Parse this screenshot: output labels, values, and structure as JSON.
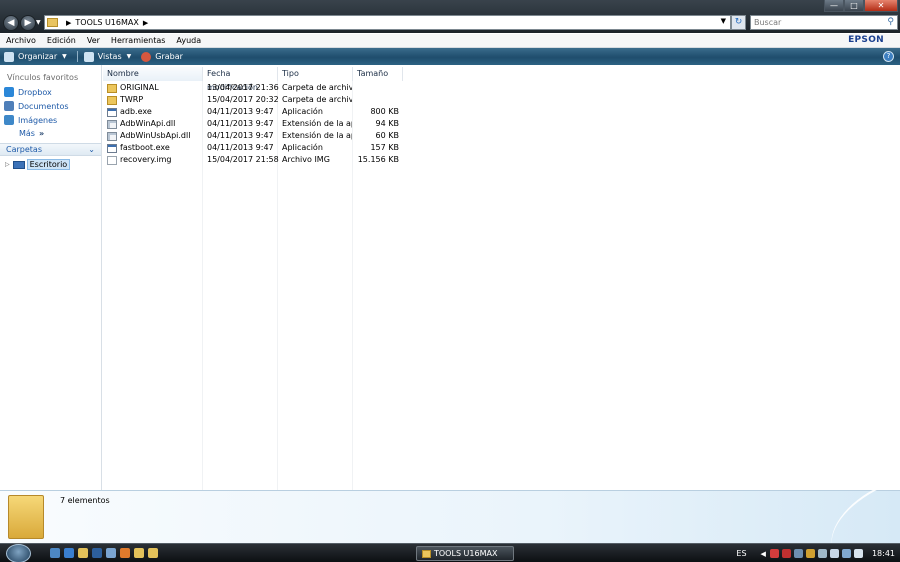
{
  "window": {
    "breadcrumb": [
      "TOOLS U16MAX"
    ],
    "search_placeholder": "Buscar",
    "controls": {
      "minimize": "—",
      "maximize": "□",
      "close": "✕"
    }
  },
  "menu": [
    "Archivo",
    "Edición",
    "Ver",
    "Herramientas",
    "Ayuda"
  ],
  "brand": "EPSON",
  "toolbar": {
    "organize": "Organizar",
    "views": "Vistas",
    "burn": "Grabar"
  },
  "sidebar": {
    "favorites_heading": "Vínculos favoritos",
    "favorites": [
      {
        "label": "Dropbox",
        "icon": "dropbox-icon",
        "color": "#2b87d8"
      },
      {
        "label": "Documentos",
        "icon": "documents-icon",
        "color": "#4f7fb9"
      },
      {
        "label": "Imágenes",
        "icon": "pictures-icon",
        "color": "#3e88c8"
      }
    ],
    "more_label": "Más",
    "folders_header": "Carpetas",
    "tree_item": "Escritorio"
  },
  "columns": [
    "Nombre",
    "Fecha modificación",
    "Tipo",
    "Tamaño"
  ],
  "files": [
    {
      "name": "ORIGINAL",
      "date": "13/04/2017 21:36",
      "type": "Carpeta de archivos",
      "size": "",
      "icon": "folder"
    },
    {
      "name": "TWRP",
      "date": "15/04/2017 20:32",
      "type": "Carpeta de archivos",
      "size": "",
      "icon": "folder"
    },
    {
      "name": "adb.exe",
      "date": "04/11/2013 9:47",
      "type": "Aplicación",
      "size": "800 KB",
      "icon": "exe"
    },
    {
      "name": "AdbWinApi.dll",
      "date": "04/11/2013 9:47",
      "type": "Extensión de la apl...",
      "size": "94 KB",
      "icon": "dll"
    },
    {
      "name": "AdbWinUsbApi.dll",
      "date": "04/11/2013 9:47",
      "type": "Extensión de la apl...",
      "size": "60 KB",
      "icon": "dll"
    },
    {
      "name": "fastboot.exe",
      "date": "04/11/2013 9:47",
      "type": "Aplicación",
      "size": "157 KB",
      "icon": "exe"
    },
    {
      "name": "recovery.img",
      "date": "15/04/2017 21:58",
      "type": "Archivo IMG",
      "size": "15.156 KB",
      "icon": "img"
    }
  ],
  "details": {
    "item_count": "7 elementos"
  },
  "taskbar": {
    "quick_launch": [
      {
        "icon": "show-desktop-icon",
        "color": "#4d88c4"
      },
      {
        "icon": "ie-icon",
        "color": "#3a7fd0"
      },
      {
        "icon": "explorer-icon",
        "color": "#e3c15a"
      },
      {
        "icon": "media-player-icon",
        "color": "#2d5f9c"
      },
      {
        "icon": "photos-icon",
        "color": "#7aa4d1"
      },
      {
        "icon": "firefox-icon",
        "color": "#e07a2c"
      },
      {
        "icon": "folder-icon",
        "color": "#e3c15a"
      },
      {
        "icon": "folder2-icon",
        "color": "#e3c15a"
      }
    ],
    "active_task": "TOOLS U16MAX",
    "language": "ES",
    "tray_icons": [
      {
        "icon": "antivirus-icon",
        "color": "#d43c3c"
      },
      {
        "icon": "shield-icon",
        "color": "#c03030"
      },
      {
        "icon": "network-icon",
        "color": "#6e8fb0"
      },
      {
        "icon": "update-icon",
        "color": "#d0a030"
      },
      {
        "icon": "safe-remove-icon",
        "color": "#a0b8c8"
      },
      {
        "icon": "volume-icon",
        "color": "#c8d8e8"
      },
      {
        "icon": "display-icon",
        "color": "#80a8d0"
      },
      {
        "icon": "sync-icon",
        "color": "#d8e4ee"
      }
    ],
    "clock": "18:41"
  }
}
